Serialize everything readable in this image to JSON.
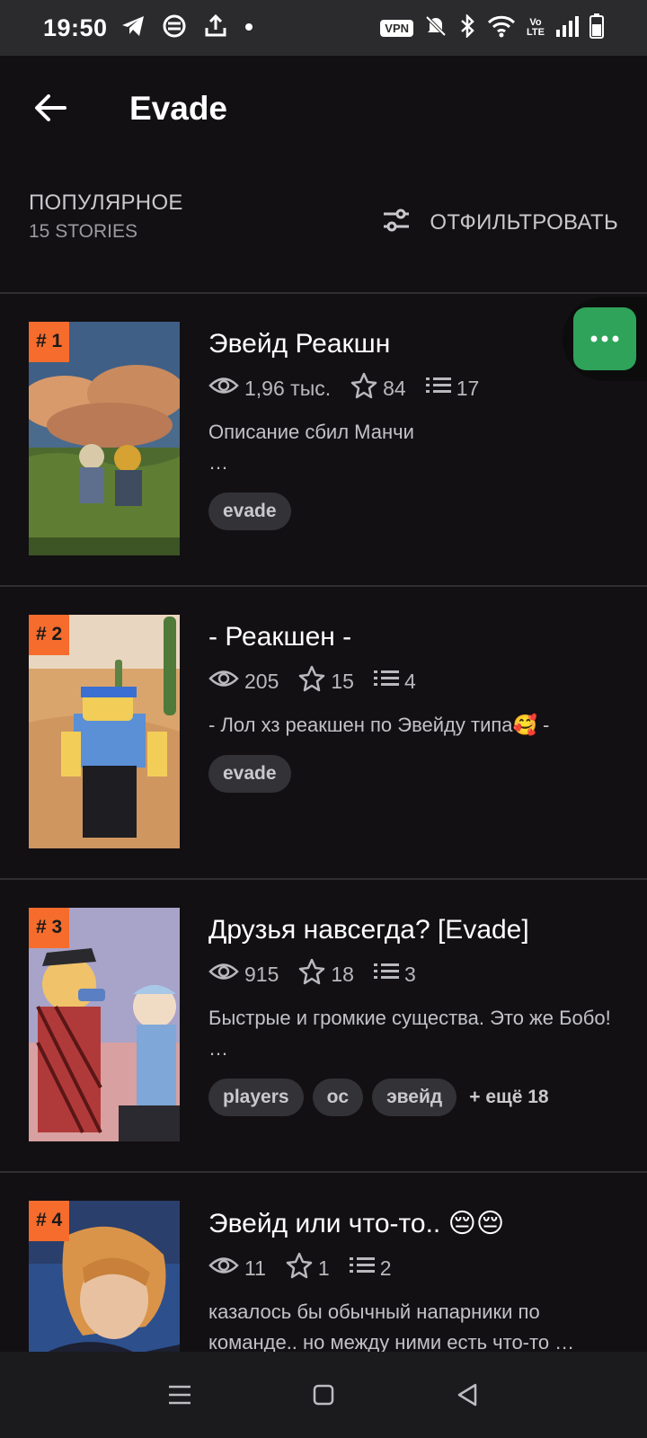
{
  "status_bar": {
    "time": "19:50",
    "icons_left": [
      "telegram-icon",
      "sync-icon",
      "upload-icon",
      "dot-icon"
    ],
    "vpn": "VPN",
    "volte": "Vo\nLTE",
    "icons_right": [
      "mute-icon",
      "bluetooth-icon",
      "wifi-icon",
      "signal-icon",
      "battery-icon"
    ]
  },
  "header": {
    "title": "Evade"
  },
  "sort": {
    "label": "ПОПУЛЯРНОЕ",
    "count": "15 STORIES",
    "filter_label": "ОТФИЛЬТРОВАТЬ"
  },
  "stories": [
    {
      "rank": "# 1",
      "title": "Эвейд Реакшн",
      "views": "1,96 тыс.",
      "stars": "84",
      "parts": "17",
      "description": "Описание сбил Манчи\n…",
      "tags": [
        "evade"
      ],
      "more_tags": ""
    },
    {
      "rank": "# 2",
      "title": "- Реакшен -",
      "views": "205",
      "stars": "15",
      "parts": "4",
      "description": "- Лол хз реакшен по Эвейду типа🥰 -",
      "tags": [
        "evade"
      ],
      "more_tags": ""
    },
    {
      "rank": "# 3",
      "title": "Друзья навсегда? [Evade]",
      "views": "915",
      "stars": "18",
      "parts": "3",
      "description": "Быстрые и громкие существа. Это же Бобо! …",
      "tags": [
        "players",
        "oc",
        "эвейд"
      ],
      "more_tags": "+ ещё 18"
    },
    {
      "rank": "# 4",
      "title": "Эвейд или что-то.. 😔😔",
      "views": "11",
      "stars": "1",
      "parts": "2",
      "description": "казалось бы обычный напарники по команде.. но между ними есть что-то …",
      "tags": [],
      "more_tags": ""
    }
  ],
  "nav": {
    "icons": [
      "menu-icon",
      "home-square-icon",
      "back-triangle-icon"
    ]
  },
  "colors": {
    "background": "#121013",
    "rank_badge": "#f56c2d",
    "fab": "#2fa35a"
  }
}
